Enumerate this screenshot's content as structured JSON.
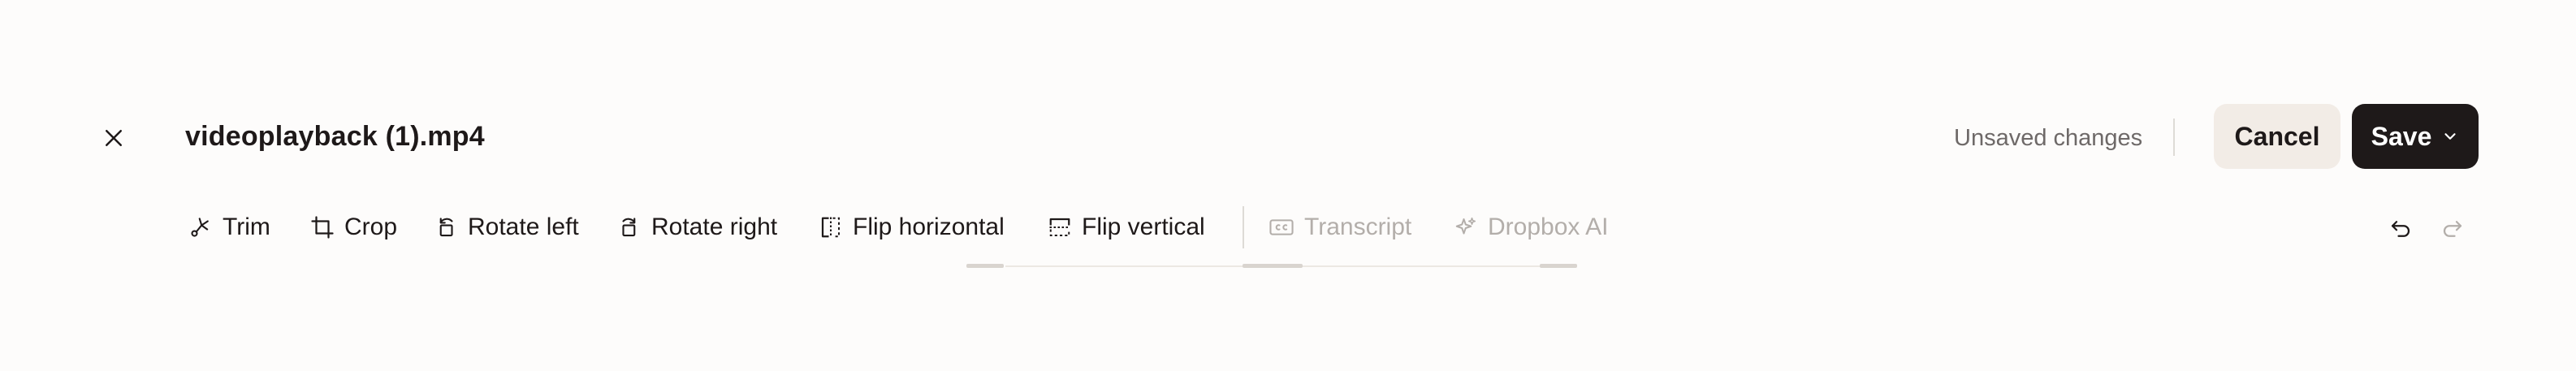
{
  "header": {
    "title": "videoplayback (1).mp4",
    "status": "Unsaved changes",
    "cancel_label": "Cancel",
    "save_label": "Save"
  },
  "toolbar": {
    "trim": "Trim",
    "crop": "Crop",
    "rotate_left": "Rotate left",
    "rotate_right": "Rotate right",
    "flip_horizontal": "Flip horizontal",
    "flip_vertical": "Flip vertical",
    "transcript": "Transcript",
    "dropbox_ai": "Dropbox AI"
  },
  "icons": [
    "close-icon",
    "scissors-icon",
    "crop-icon",
    "rotate-left-icon",
    "rotate-right-icon",
    "flip-horizontal-icon",
    "flip-vertical-icon",
    "closed-caption-icon",
    "sparkle-icon",
    "undo-icon",
    "redo-icon",
    "chevron-down-icon"
  ],
  "colors": {
    "text": "#1e1919",
    "muted": "#6e6968",
    "disabled": "#b3aeaa",
    "cancel_bg": "#f2ece6",
    "save_bg": "#1e1919",
    "background": "#fdfcfb"
  }
}
